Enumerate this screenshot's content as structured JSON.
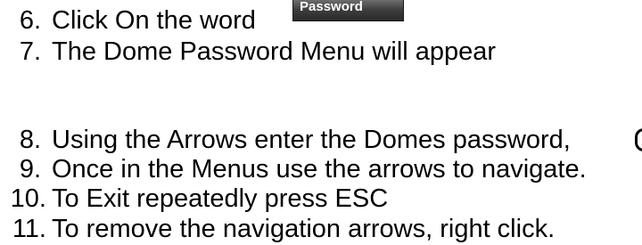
{
  "steps": [
    {
      "number": "6.",
      "text": "Click On the word"
    },
    {
      "number": "7.",
      "text": "The Dome Password Menu will appear"
    },
    {
      "number": "8.",
      "text": "Using the Arrows enter the Domes password,"
    },
    {
      "number": "9.",
      "text": "Once in the Menus use the arrows to navigate."
    },
    {
      "number": "10.",
      "text": "To Exit repeatedly press ESC"
    },
    {
      "number": "11.",
      "text": "To remove the navigation arrows, right click."
    }
  ],
  "password_button": {
    "label": "Password"
  }
}
